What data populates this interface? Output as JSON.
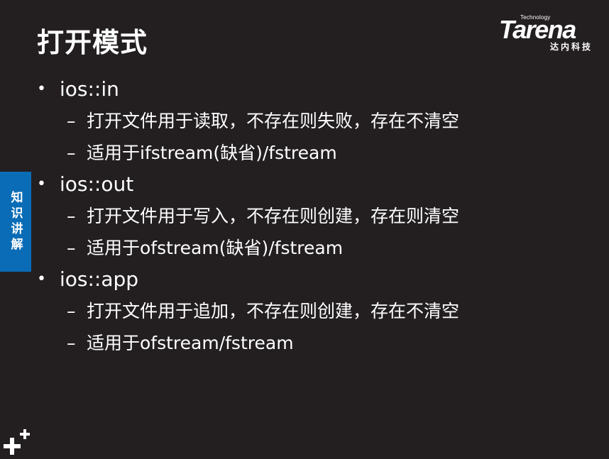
{
  "slide": {
    "title": "打开模式",
    "side_tab": "知识讲解"
  },
  "logo": {
    "technology": "Technology",
    "name": "Tarena",
    "name_cn": "达内科技"
  },
  "items": [
    {
      "label": "ios::in",
      "subs": [
        "打开文件用于读取，不存在则失败，存在不清空",
        "适用于ifstream(缺省)/fstream"
      ]
    },
    {
      "label": "ios::out",
      "subs": [
        "打开文件用于写入，不存在则创建，存在则清空",
        "适用于ofstream(缺省)/fstream"
      ]
    },
    {
      "label": "ios::app",
      "subs": [
        "打开文件用于追加，不存在则创建，存在不清空",
        "适用于ofstream/fstream"
      ]
    }
  ],
  "colors": {
    "background": "#231f20",
    "side_tab": "#0a6cb6",
    "text": "#ffffff"
  },
  "icons": {
    "bullet": "•",
    "dash": "–",
    "corner": "plus-icon"
  }
}
